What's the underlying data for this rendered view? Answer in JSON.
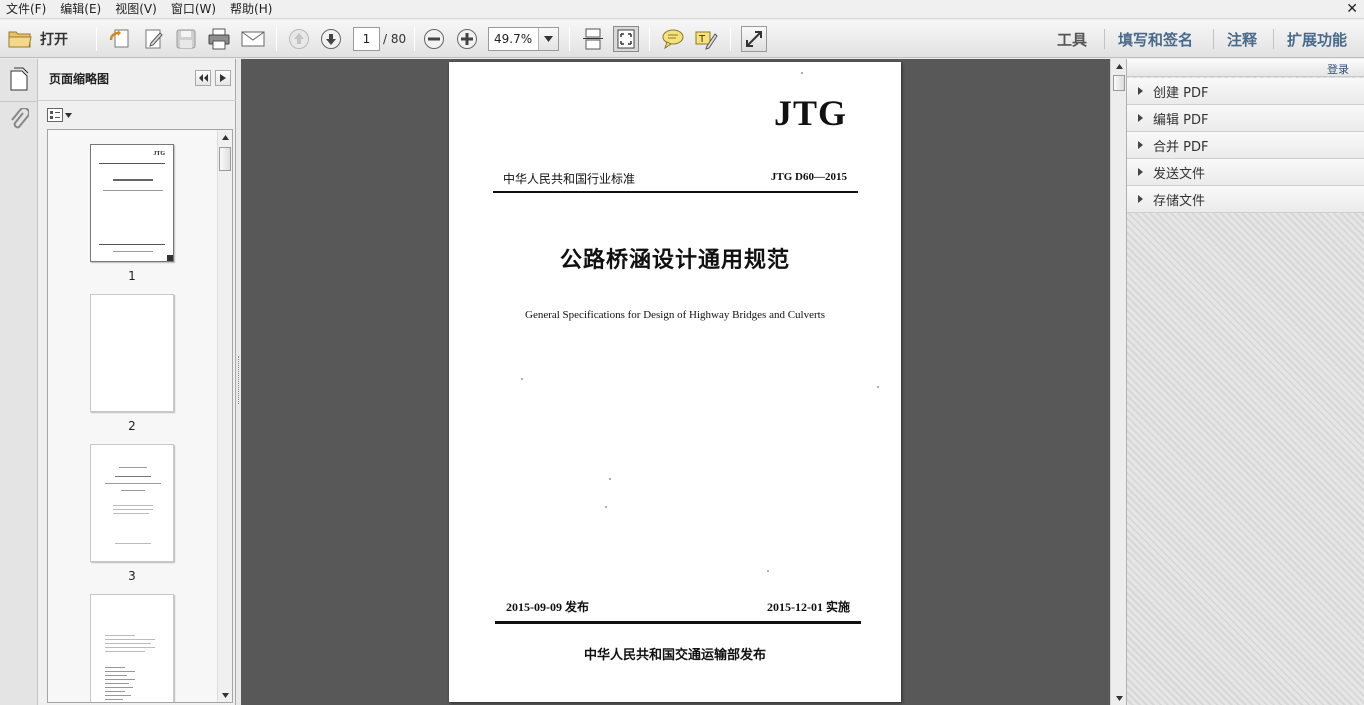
{
  "menu": [
    "文件(F)",
    "编辑(E)",
    "视图(V)",
    "窗口(W)",
    "帮助(H)"
  ],
  "toolbar": {
    "open_label": "打开",
    "page_current": "1",
    "page_total": "/ 80",
    "zoom": "49.7%"
  },
  "right_links": [
    "工具",
    "填写和签名",
    "注释",
    "扩展功能"
  ],
  "thumbnails": {
    "title": "页面缩略图",
    "pages": [
      "1",
      "2",
      "3"
    ]
  },
  "document": {
    "logo": "JTG",
    "header_left": "中华人民共和国行业标准",
    "header_right": "JTG D60—2015",
    "title": "公路桥涵设计通用规范",
    "subtitle": "General Specifications for Design of Highway Bridges and Culverts",
    "date_left": "2015-09-09 发布",
    "date_right": "2015-12-01 实施",
    "publisher": "中华人民共和国交通运输部发布"
  },
  "task_pane": {
    "login": "登录",
    "items": [
      "创建 PDF",
      "编辑 PDF",
      "合并 PDF",
      "发送文件",
      "存储文件"
    ]
  },
  "colors": {
    "doc_background": "#585858",
    "link_blue": "#4a6a8c"
  }
}
